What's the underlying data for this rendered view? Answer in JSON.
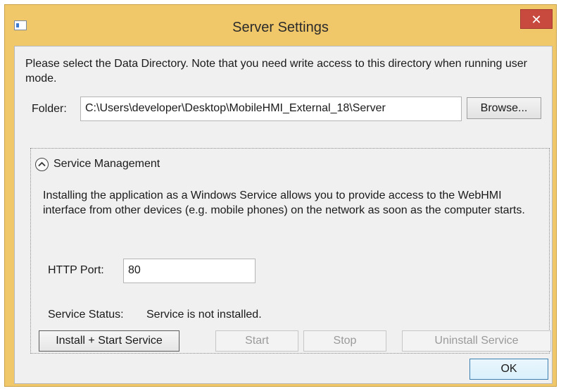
{
  "window": {
    "title": "Server Settings",
    "close_glyph": "✕"
  },
  "intro_text": "Please select the Data Directory. Note that you need write access to this directory when running user mode.",
  "folder": {
    "label": "Folder:",
    "value": "C:\\Users\\developer\\Desktop\\MobileHMI_External_18\\Server",
    "browse_label": "Browse..."
  },
  "service": {
    "header": "Service Management",
    "description": "Installing the application as a Windows Service allows you to provide  access to the WebHMI interface from other devices (e.g. mobile phones) on the network as soon as the computer starts.",
    "port_label": "HTTP Port:",
    "port_value": "80",
    "status_label": "Service Status:",
    "status_value": "Service is not installed.",
    "buttons": {
      "install": "Install + Start Service",
      "start": "Start",
      "stop": "Stop",
      "uninstall": "Uninstall Service"
    }
  },
  "ok_label": "OK"
}
